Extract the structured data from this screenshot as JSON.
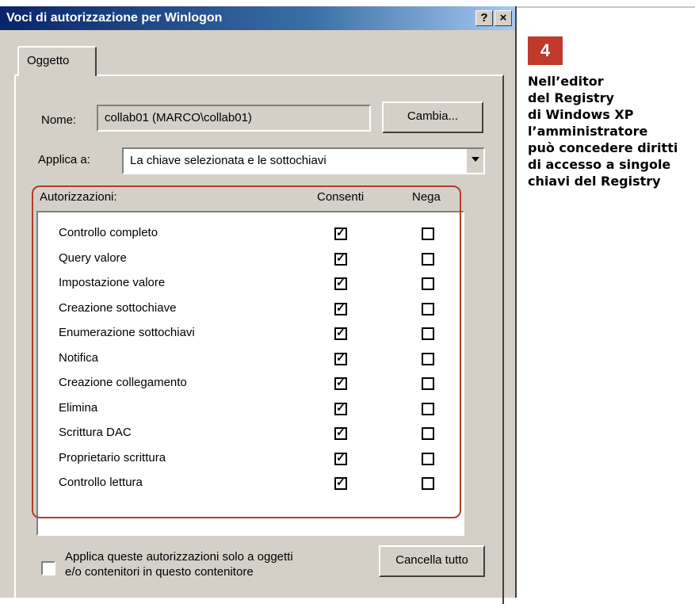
{
  "window": {
    "title": "Voci di autorizzazione per Winlogon",
    "help_btn": "?",
    "close_btn": "×"
  },
  "tab": {
    "label": "Oggetto"
  },
  "name_row": {
    "label": "Nome:",
    "value": "collab01 (MARCO\\collab01)",
    "button": "Cambia..."
  },
  "apply_row": {
    "label": "Applica a:",
    "value": "La chiave selezionata e le sottochiavi"
  },
  "permissions": {
    "header": "Autorizzazioni:",
    "col_allow": "Consenti",
    "col_deny": "Nega",
    "items": [
      {
        "name": "Controllo completo",
        "allow": true,
        "deny": false
      },
      {
        "name": "Query valore",
        "allow": true,
        "deny": false
      },
      {
        "name": "Impostazione valore",
        "allow": true,
        "deny": false
      },
      {
        "name": "Creazione sottochiave",
        "allow": true,
        "deny": false
      },
      {
        "name": "Enumerazione sottochiavi",
        "allow": true,
        "deny": false
      },
      {
        "name": "Notifica",
        "allow": true,
        "deny": false
      },
      {
        "name": "Creazione collegamento",
        "allow": true,
        "deny": false
      },
      {
        "name": "Elimina",
        "allow": true,
        "deny": false
      },
      {
        "name": "Scrittura DAC",
        "allow": true,
        "deny": false
      },
      {
        "name": "Proprietario scrittura",
        "allow": true,
        "deny": false
      },
      {
        "name": "Controllo lettura",
        "allow": true,
        "deny": false
      }
    ]
  },
  "bottom": {
    "apply_only_line1": "Applica queste autorizzazioni solo a oggetti",
    "apply_only_line2": "e/o contenitori in questo contenitore",
    "clear_all": "Cancella tutto"
  },
  "caption": {
    "number": "4",
    "lines": [
      "Nell’editor",
      "del Registry",
      "di Windows XP",
      "l’amministratore",
      "può concedere diritti",
      "di accesso a singole",
      "chiavi del Registry"
    ]
  },
  "colors": {
    "highlight": "#b03d2a",
    "badge": "#c0392b",
    "titlebar": "#0a246a"
  }
}
